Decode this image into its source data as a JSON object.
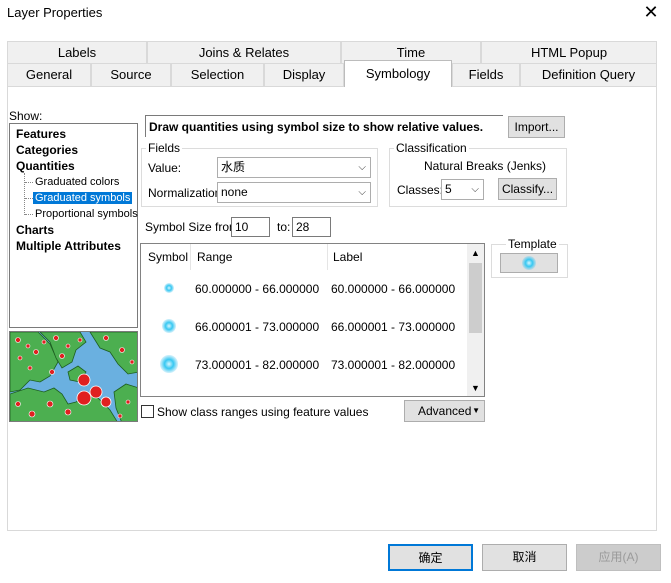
{
  "window": {
    "title": "Layer Properties"
  },
  "tabs_row1": [
    "Labels",
    "Joins & Relates",
    "Time",
    "HTML Popup"
  ],
  "tabs_row2": [
    "General",
    "Source",
    "Selection",
    "Display",
    "Symbology",
    "Fields",
    "Definition Query"
  ],
  "show": {
    "label": "Show:",
    "items": [
      {
        "label": "Features",
        "level": 0
      },
      {
        "label": "Categories",
        "level": 0
      },
      {
        "label": "Quantities",
        "level": 0
      },
      {
        "label": "Graduated colors",
        "level": 1
      },
      {
        "label": "Graduated symbols",
        "level": 1,
        "selected": true
      },
      {
        "label": "Proportional symbols",
        "level": 1
      },
      {
        "label": "Charts",
        "level": 0
      },
      {
        "label": "Multiple Attributes",
        "level": 0
      }
    ]
  },
  "description": "Draw quantities using symbol size to show relative values.",
  "import_button": "Import...",
  "fields": {
    "group_title": "Fields",
    "value_label": "Value:",
    "value": "水质",
    "normalization_label": "Normalization:",
    "normalization": "none"
  },
  "classification": {
    "group_title": "Classification",
    "method": "Natural Breaks (Jenks)",
    "classes_label": "Classes:",
    "classes": "5",
    "classify_button": "Classify..."
  },
  "symbol_size": {
    "from_label": "Symbol Size from:",
    "from": "10",
    "to_label": "to:",
    "to": "28"
  },
  "table": {
    "headers": [
      "Symbol",
      "Range",
      "Label"
    ],
    "rows": [
      {
        "range": "60.000000 - 66.000000",
        "label": "60.000000 - 66.000000",
        "size": 10
      },
      {
        "range": "66.000001 - 73.000000",
        "label": "66.000001 - 73.000000",
        "size": 14
      },
      {
        "range": "73.000001 - 82.000000",
        "label": "73.000001 - 82.000000",
        "size": 18
      }
    ]
  },
  "template": {
    "label": "Template"
  },
  "show_class_ranges": {
    "label": "Show class ranges using feature values",
    "checked": false
  },
  "advanced_button": "Advanced",
  "footer": {
    "ok": "确定",
    "cancel": "取消",
    "apply": "应用(A)"
  },
  "colors": {
    "selection": "#0078d7",
    "symbol": "#37c8f2",
    "map_land": "#4caf50",
    "map_water": "#6ab0e0",
    "map_point": "#e02020"
  }
}
